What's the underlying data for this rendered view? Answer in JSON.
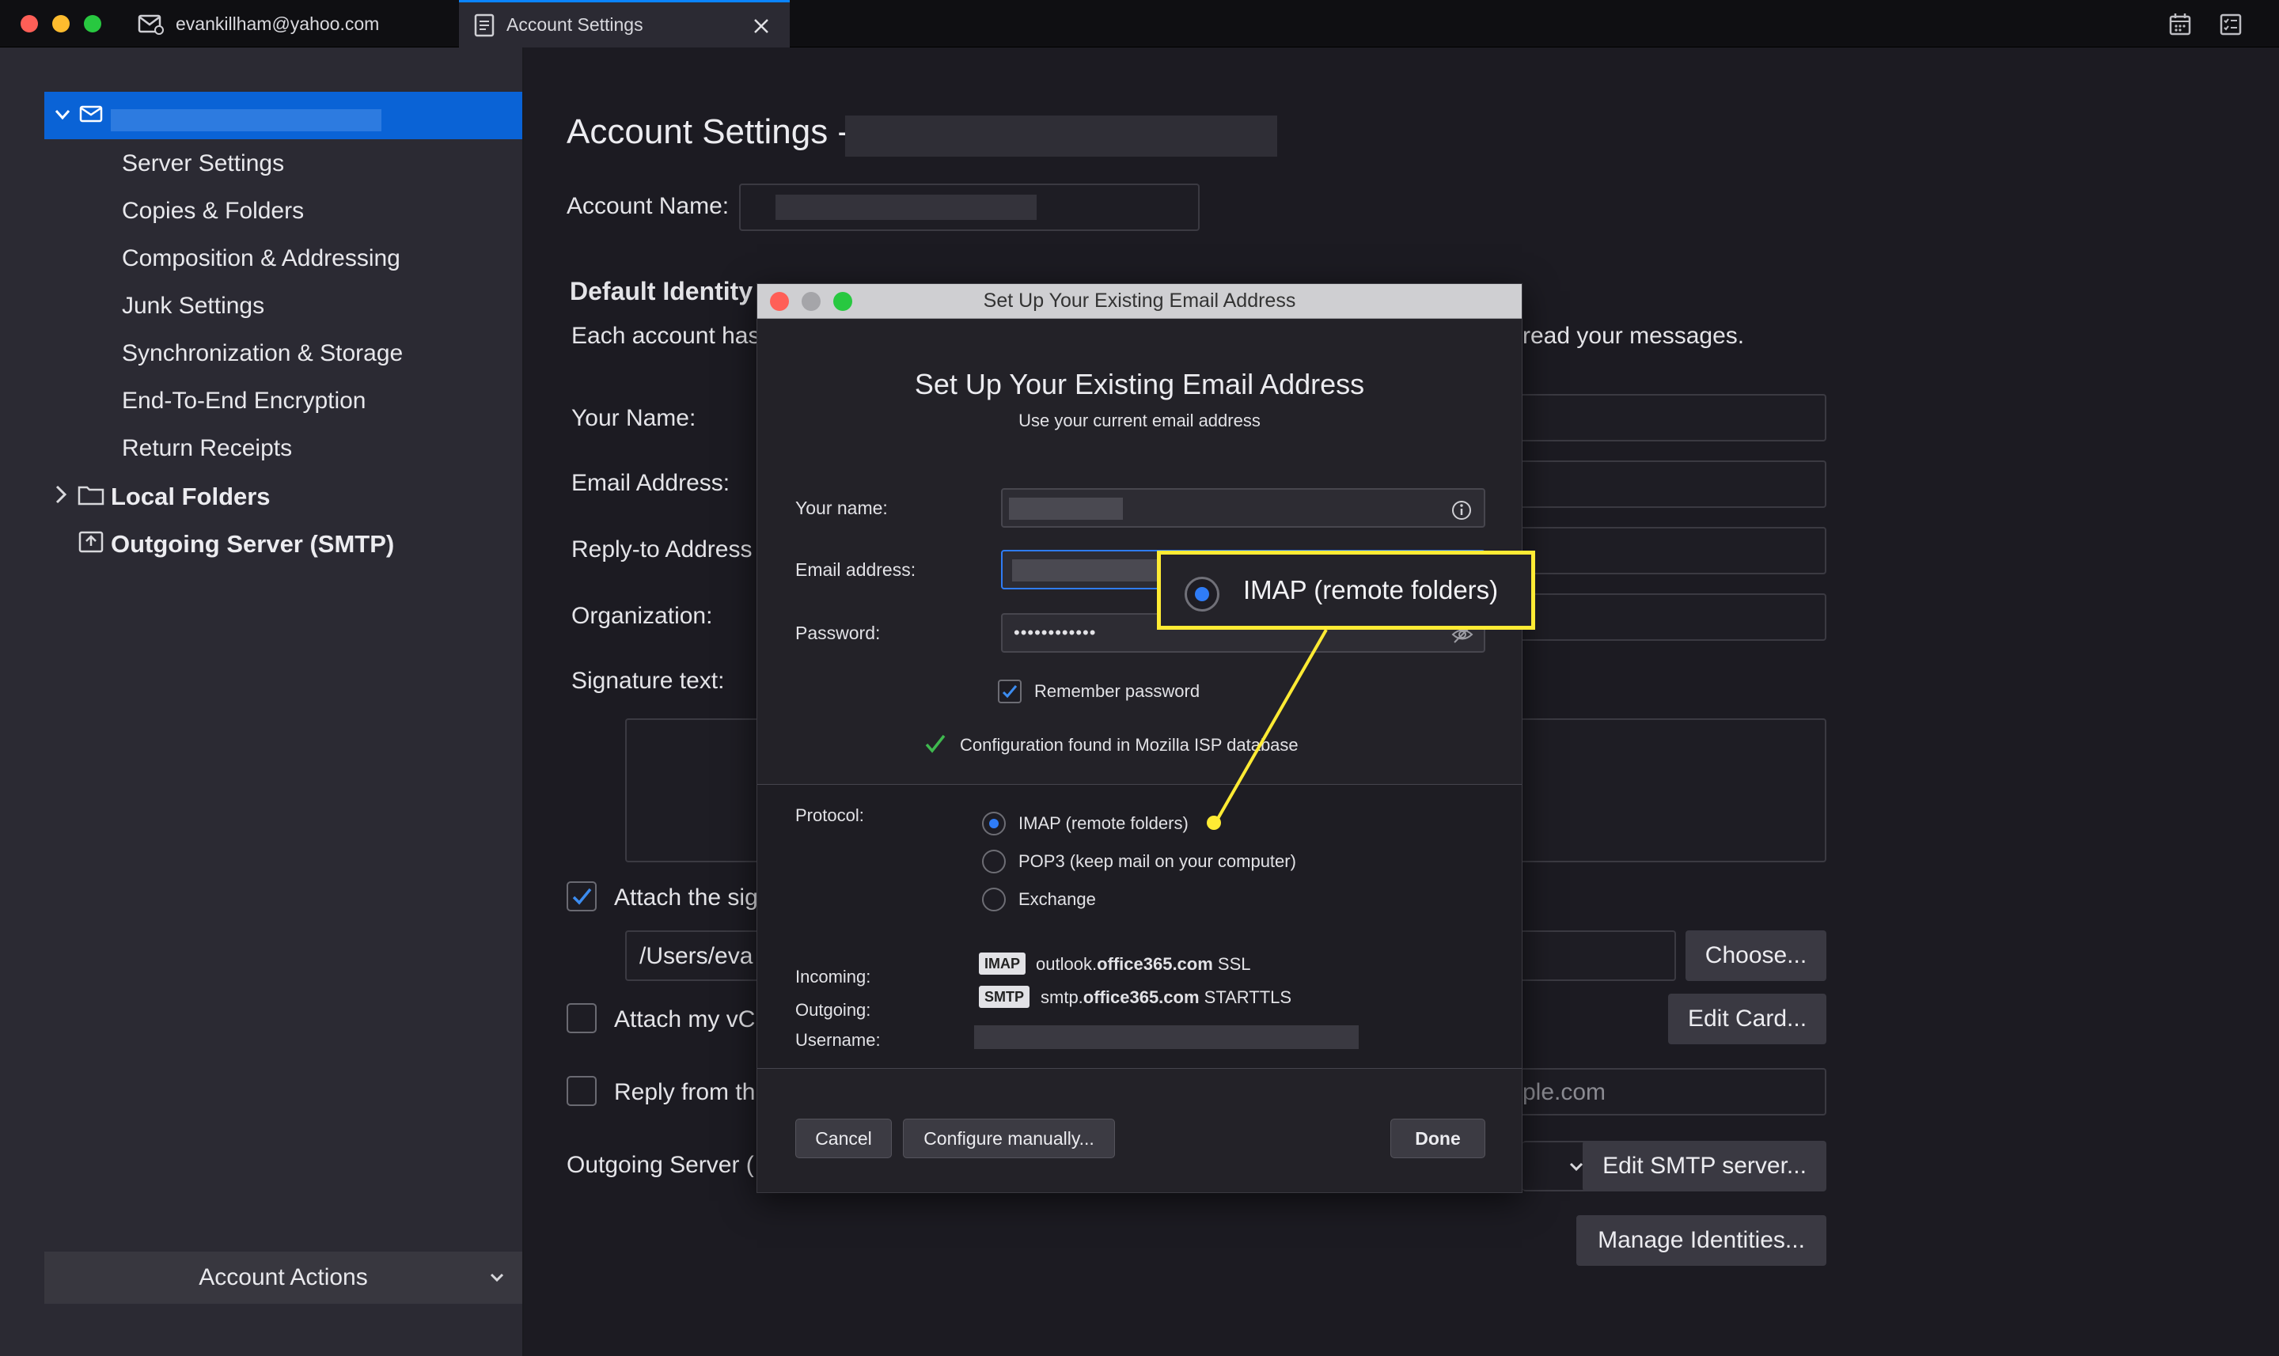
{
  "tabs": [
    {
      "label": "evankillham@yahoo.com"
    },
    {
      "label": "Account Settings"
    }
  ],
  "sidebar": {
    "items": [
      {
        "label": "Server Settings"
      },
      {
        "label": "Copies & Folders"
      },
      {
        "label": "Composition & Addressing"
      },
      {
        "label": "Junk Settings"
      },
      {
        "label": "Synchronization & Storage"
      },
      {
        "label": "End-To-End Encryption"
      },
      {
        "label": "Return Receipts"
      }
    ],
    "local_folders": "Local Folders",
    "outgoing_server": "Outgoing Server (SMTP)",
    "account_actions": "Account Actions"
  },
  "main": {
    "title": "Account Settings -",
    "account_name_label": "Account Name:",
    "default_identity": "Default Identity",
    "each_account_prefix": "Each account has",
    "each_account_suffix": "read your messages.",
    "your_name_label": "Your Name:",
    "email_label": "Email Address:",
    "reply_to_label": "Reply-to Address",
    "organization_label": "Organization:",
    "signature_label": "Signature text:",
    "attach_sig_label": "Attach the sig",
    "sig_path": "/Users/eva",
    "choose_button": "Choose...",
    "attach_vcard_label": "Attach my vC",
    "edit_card_button": "Edit Card...",
    "reply_from_label": "Reply from th",
    "reply_from_value": "ple.com",
    "outgoing_server_label": "Outgoing Server (",
    "edit_smtp_button": "Edit SMTP server...",
    "manage_identities_button": "Manage Identities..."
  },
  "dialog": {
    "window_title": "Set Up Your Existing Email Address",
    "heading": "Set Up Your Existing Email Address",
    "subheading": "Use your current email address",
    "name_label": "Your name:",
    "email_label": "Email address:",
    "password_label": "Password:",
    "password_value": "••••••••••••",
    "remember_password": "Remember password",
    "config_found": "Configuration found in Mozilla ISP database",
    "protocol_label": "Protocol:",
    "protocols": [
      {
        "label": "IMAP (remote folders)",
        "selected": true
      },
      {
        "label": "POP3 (keep mail on your computer)",
        "selected": false
      },
      {
        "label": "Exchange",
        "selected": false
      }
    ],
    "incoming_label": "Incoming:",
    "incoming_tag": "IMAP",
    "incoming_host_prefix": "outlook.",
    "incoming_host_bold": "office365.com",
    "incoming_security": "SSL",
    "outgoing_label": "Outgoing:",
    "outgoing_tag": "SMTP",
    "outgoing_host_prefix": "smtp.",
    "outgoing_host_bold": "office365.com",
    "outgoing_security": "STARTTLS",
    "username_label": "Username:",
    "cancel_button": "Cancel",
    "configure_manually_button": "Configure manually...",
    "done_button": "Done"
  },
  "callout": {
    "label": "IMAP (remote folders)"
  },
  "colors": {
    "accent": "#0a63d6",
    "callout": "#ffeb34",
    "radio_on": "#2f7cf6",
    "check": "#3fb94f"
  }
}
